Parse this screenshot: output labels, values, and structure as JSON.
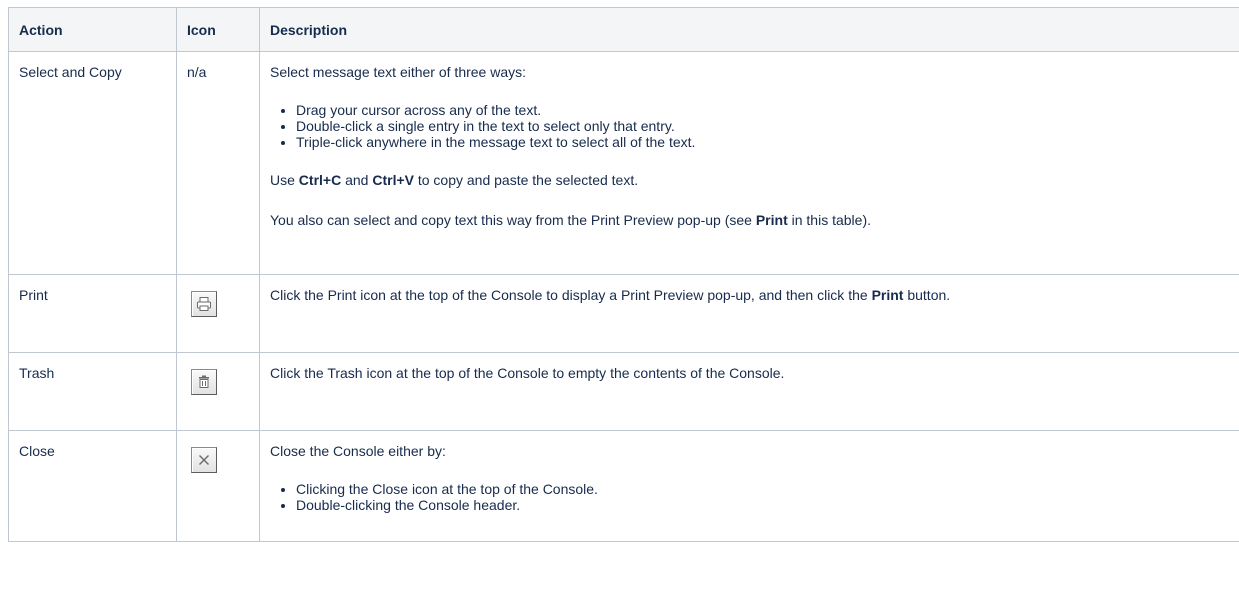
{
  "headers": {
    "action": "Action",
    "icon": "Icon",
    "description": "Description"
  },
  "rows": {
    "select": {
      "action": "Select and Copy",
      "icon": "n/a",
      "intro": "Select message text either of three ways:",
      "bullets": [
        "Drag your cursor across any of the text.",
        "Double-click a single entry in the text to select only that entry.",
        "Triple-click anywhere in the message text to select all of the text."
      ],
      "copy_prefix": "Use ",
      "copy_key1": "Ctrl+C",
      "copy_mid": " and ",
      "copy_key2": "Ctrl+V",
      "copy_suffix": " to copy and paste the selected text.",
      "note_prefix": "You also can select and copy text this way from the Print Preview pop-up (see ",
      "note_bold": "Print",
      "note_suffix": " in this table)."
    },
    "print": {
      "action": "Print",
      "icon_name": "print-icon",
      "desc_prefix": "Click the Print icon at the top of the Console to display a Print Preview pop-up, and then click the ",
      "desc_bold": "Print",
      "desc_suffix": " button."
    },
    "trash": {
      "action": "Trash",
      "icon_name": "trash-icon",
      "desc": "Click the Trash icon at the top of the Console to empty the contents of the Console."
    },
    "close": {
      "action": "Close",
      "icon_name": "close-icon",
      "intro": "Close the Console either by:",
      "bullets": [
        "Clicking the Close icon at the top of the Console.",
        "Double-clicking the Console header."
      ]
    }
  }
}
